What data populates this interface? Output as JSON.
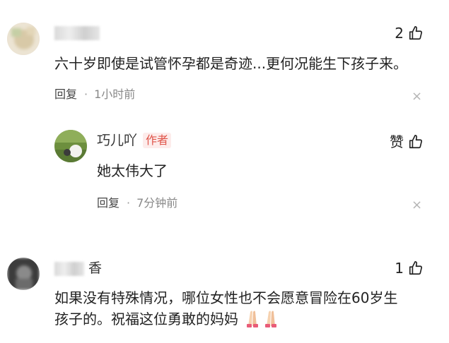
{
  "comments": [
    {
      "user": "",
      "likes": "2",
      "text": "六十岁即使是试管怀孕都是奇迹...更何况能生下孩子来。",
      "reply_label": "回复",
      "separator": "·",
      "time": "1小时前",
      "replies": [
        {
          "user": "巧儿吖",
          "badge": "作者",
          "like_label": "赞",
          "text": "她太伟大了",
          "reply_label": "回复",
          "separator": "·",
          "time": "7分钟前"
        }
      ]
    },
    {
      "user": "香",
      "likes": "1",
      "text_line1": "如果没有特殊情况，哪位女性也不会愿意冒险在60岁生",
      "text_line2": "孩子的。祝福这位勇敢的妈妈",
      "emoji": [
        "folded-hands-emoji",
        "folded-hands-emoji"
      ]
    }
  ],
  "close_symbol": "×",
  "colors": {
    "badge_bg": "#fdeceb",
    "badge_text": "#e0554a"
  }
}
